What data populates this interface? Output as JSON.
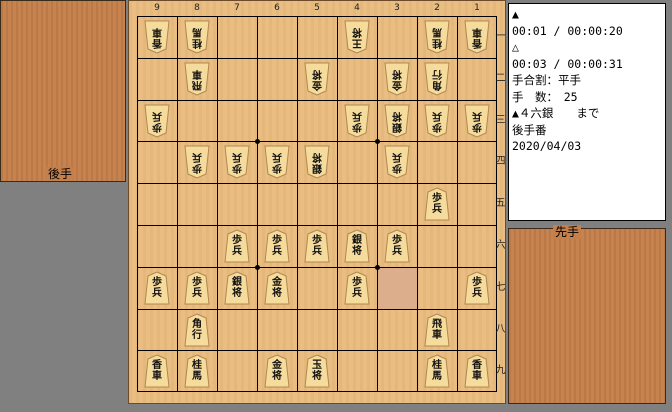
{
  "gote_stand": {
    "label": "後手"
  },
  "sente_stand": {
    "label": "先手"
  },
  "file_labels": [
    "9",
    "8",
    "7",
    "6",
    "5",
    "4",
    "3",
    "2",
    "1"
  ],
  "rank_labels": [
    "一",
    "二",
    "三",
    "四",
    "五",
    "六",
    "七",
    "八",
    "九"
  ],
  "info": {
    "gote_turn_mark": "▲",
    "time_line_1": "00:01 / 00:00:20",
    "sente_turn_mark": "△",
    "time_line_2": "00:03 / 00:00:31",
    "handicap": "手合割：平手",
    "move_count": "手　数：　25",
    "last_move": "▲４六銀　　まで",
    "side_to_move": "後手番",
    "date": "2020/04/03"
  },
  "last_move_square": {
    "file": 3,
    "rank": 7
  },
  "pieces": [
    {
      "file": 9,
      "rank": 1,
      "owner": "gote",
      "text": "香車"
    },
    {
      "file": 8,
      "rank": 1,
      "owner": "gote",
      "text": "桂馬"
    },
    {
      "file": 4,
      "rank": 1,
      "owner": "gote",
      "text": "王将"
    },
    {
      "file": 2,
      "rank": 1,
      "owner": "gote",
      "text": "桂馬"
    },
    {
      "file": 1,
      "rank": 1,
      "owner": "gote",
      "text": "香車"
    },
    {
      "file": 8,
      "rank": 2,
      "owner": "gote",
      "text": "飛車"
    },
    {
      "file": 5,
      "rank": 2,
      "owner": "gote",
      "text": "金将"
    },
    {
      "file": 3,
      "rank": 2,
      "owner": "gote",
      "text": "金将"
    },
    {
      "file": 2,
      "rank": 2,
      "owner": "gote",
      "text": "角行"
    },
    {
      "file": 9,
      "rank": 3,
      "owner": "gote",
      "text": "歩兵"
    },
    {
      "file": 4,
      "rank": 3,
      "owner": "gote",
      "text": "歩兵"
    },
    {
      "file": 3,
      "rank": 3,
      "owner": "gote",
      "text": "銀将"
    },
    {
      "file": 2,
      "rank": 3,
      "owner": "gote",
      "text": "歩兵"
    },
    {
      "file": 1,
      "rank": 3,
      "owner": "gote",
      "text": "歩兵"
    },
    {
      "file": 8,
      "rank": 4,
      "owner": "gote",
      "text": "歩兵"
    },
    {
      "file": 7,
      "rank": 4,
      "owner": "gote",
      "text": "歩兵"
    },
    {
      "file": 6,
      "rank": 4,
      "owner": "gote",
      "text": "歩兵"
    },
    {
      "file": 5,
      "rank": 4,
      "owner": "gote",
      "text": "銀将"
    },
    {
      "file": 3,
      "rank": 4,
      "owner": "gote",
      "text": "歩兵"
    },
    {
      "file": 2,
      "rank": 5,
      "owner": "sente",
      "text": "歩兵"
    },
    {
      "file": 7,
      "rank": 6,
      "owner": "sente",
      "text": "歩兵"
    },
    {
      "file": 6,
      "rank": 6,
      "owner": "sente",
      "text": "歩兵"
    },
    {
      "file": 5,
      "rank": 6,
      "owner": "sente",
      "text": "歩兵"
    },
    {
      "file": 4,
      "rank": 6,
      "owner": "sente",
      "text": "銀将"
    },
    {
      "file": 3,
      "rank": 6,
      "owner": "sente",
      "text": "歩兵"
    },
    {
      "file": 9,
      "rank": 7,
      "owner": "sente",
      "text": "歩兵"
    },
    {
      "file": 8,
      "rank": 7,
      "owner": "sente",
      "text": "歩兵"
    },
    {
      "file": 7,
      "rank": 7,
      "owner": "sente",
      "text": "銀将"
    },
    {
      "file": 6,
      "rank": 7,
      "owner": "sente",
      "text": "金将"
    },
    {
      "file": 4,
      "rank": 7,
      "owner": "sente",
      "text": "歩兵"
    },
    {
      "file": 1,
      "rank": 7,
      "owner": "sente",
      "text": "歩兵"
    },
    {
      "file": 8,
      "rank": 8,
      "owner": "sente",
      "text": "角行"
    },
    {
      "file": 2,
      "rank": 8,
      "owner": "sente",
      "text": "飛車"
    },
    {
      "file": 9,
      "rank": 9,
      "owner": "sente",
      "text": "香車"
    },
    {
      "file": 8,
      "rank": 9,
      "owner": "sente",
      "text": "桂馬"
    },
    {
      "file": 6,
      "rank": 9,
      "owner": "sente",
      "text": "金将"
    },
    {
      "file": 5,
      "rank": 9,
      "owner": "sente",
      "text": "玉将"
    },
    {
      "file": 2,
      "rank": 9,
      "owner": "sente",
      "text": "桂馬"
    },
    {
      "file": 1,
      "rank": 9,
      "owner": "sente",
      "text": "香車"
    }
  ]
}
